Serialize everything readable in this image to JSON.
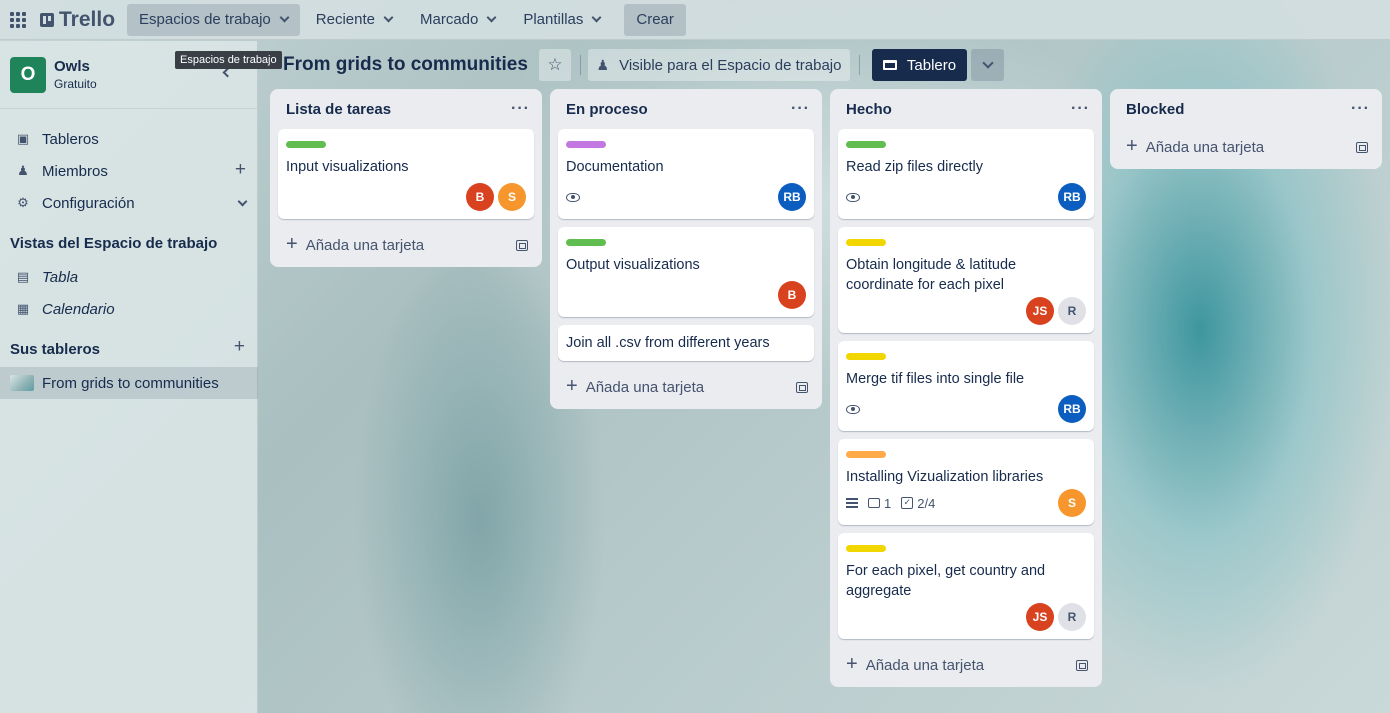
{
  "nav": {
    "logo": "Trello",
    "items": [
      {
        "label": "Espacios de trabajo"
      },
      {
        "label": "Reciente"
      },
      {
        "label": "Marcado"
      },
      {
        "label": "Plantillas"
      }
    ],
    "create": "Crear"
  },
  "tooltip": "Espacios de trabajo",
  "sidebar": {
    "workspace": {
      "initial": "O",
      "name": "Owls",
      "plan": "Gratuito"
    },
    "items": [
      {
        "label": "Tableros"
      },
      {
        "label": "Miembros"
      },
      {
        "label": "Configuración"
      }
    ],
    "views_heading": "Vistas del Espacio de trabajo",
    "views": [
      {
        "label": "Tabla"
      },
      {
        "label": "Calendario"
      }
    ],
    "boards_heading": "Sus tableros",
    "boards": [
      {
        "label": "From grids to communities"
      }
    ]
  },
  "board": {
    "title": "From grids to communities",
    "visibility": "Visible para el Espacio de trabajo",
    "view": "Tablero"
  },
  "add_card_label": "Añada una tarjeta",
  "colors": {
    "green": "#61bd4f",
    "purple": "#c377e0",
    "yellow": "#f2d600",
    "orange": "#ffab4a",
    "avatar_b": "#d9421f",
    "avatar_s": "#f7962c",
    "avatar_rb": "#0b5dbf",
    "avatar_r": "#dfe1e6"
  },
  "lists": [
    {
      "title": "Lista de tareas",
      "cards": [
        {
          "label": "green",
          "title": "Input visualizations",
          "members": [
            "B",
            "S"
          ]
        }
      ]
    },
    {
      "title": "En proceso",
      "cards": [
        {
          "label": "purple",
          "title": "Documentation",
          "watch": true,
          "members": [
            "RB"
          ]
        },
        {
          "label": "green",
          "title": "Output visualizations",
          "members": [
            "B"
          ]
        },
        {
          "title": "Join all .csv from different years"
        }
      ]
    },
    {
      "title": "Hecho",
      "cards": [
        {
          "label": "green",
          "title": "Read zip files directly",
          "watch": true,
          "members": [
            "RB"
          ]
        },
        {
          "label": "yellow",
          "title": "Obtain longitude & latitude coordinate for each pixel",
          "members": [
            "JS",
            "R"
          ]
        },
        {
          "label": "yellow",
          "title": "Merge tif files into single file",
          "watch": true,
          "members": [
            "RB"
          ]
        },
        {
          "label": "orange",
          "title": "Installing Vizualization libraries",
          "description": true,
          "comments": "1",
          "checklist": "2/4",
          "members": [
            "S"
          ]
        },
        {
          "label": "yellow",
          "title": "For each pixel, get country and aggregate",
          "members": [
            "JS",
            "R"
          ]
        }
      ]
    },
    {
      "title": "Blocked",
      "cards": []
    }
  ]
}
